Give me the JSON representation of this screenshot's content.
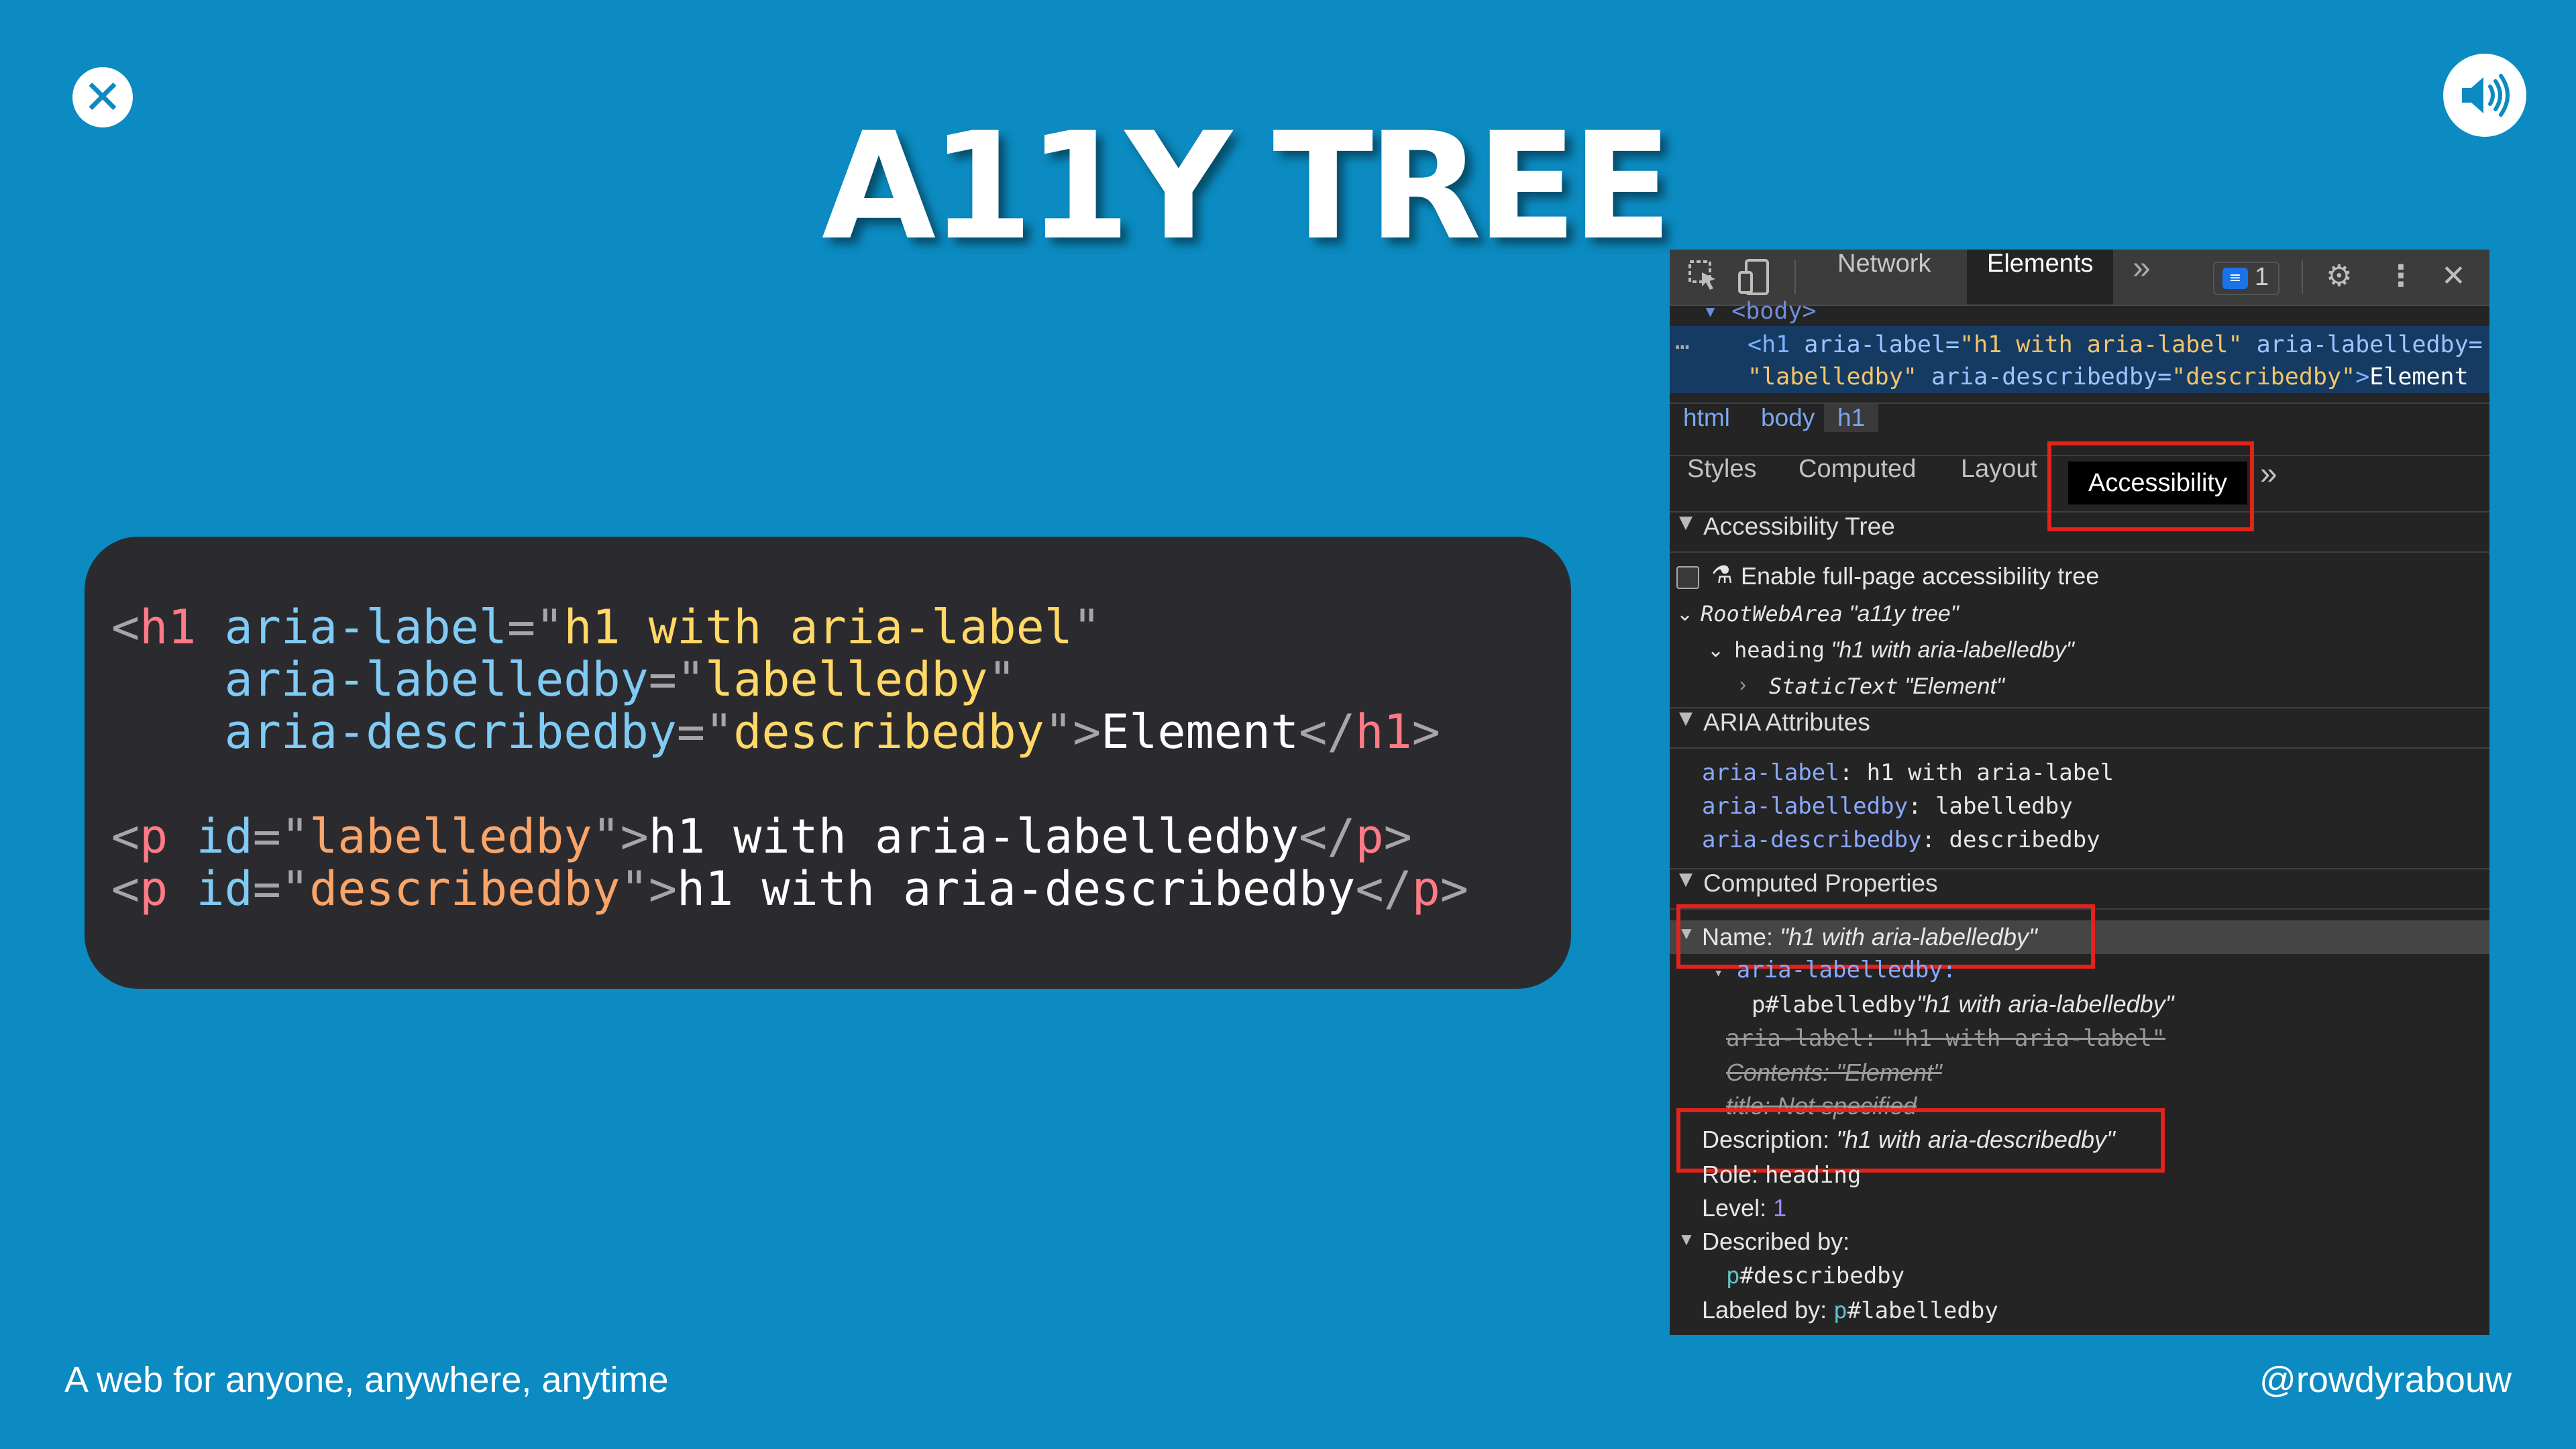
{
  "slide": {
    "title": "A11Y TREE",
    "footer_left": "A web for anyone, anywhere, anytime",
    "footer_right": "@rowdyrabouw",
    "close_icon": "close-icon",
    "sound_icon": "speaker-icon"
  },
  "code": {
    "l1": {
      "open": "<",
      "tag": "h1",
      "a1": "aria-label",
      "eq": "=",
      "q": "\"",
      "v1": "h1 with aria-label"
    },
    "l2": {
      "a2": "aria-labelledby",
      "v2": "labelledby"
    },
    "l3": {
      "a3": "aria-describedby",
      "v3": "describedby",
      "close": ">",
      "text": "Element",
      "end_open": "</",
      "tag": "h1",
      "end_close": ">"
    },
    "l5": {
      "tag": "p",
      "a": "id",
      "v": "labelledby",
      "text": "h1 with aria-labelledby"
    },
    "l6": {
      "tag": "p",
      "a": "id",
      "v": "describedby",
      "text": "h1 with aria-describedby"
    }
  },
  "devtools": {
    "tabs": {
      "network": "Network",
      "elements": "Elements",
      "more": "»",
      "issues_count": "1"
    },
    "dom": {
      "body_tag": "▾ <body>",
      "dots": "…",
      "line1": {
        "tag_open": "<h1 ",
        "a1": "aria-label",
        "v1": "\"h1 with aria-label\"",
        "a2": " aria-labelledby="
      },
      "line2": {
        "v2": "\"labelledby\"",
        "a3": " aria-describedby=",
        "v3": "\"describedby\"",
        "gt": ">",
        "text": "Element"
      }
    },
    "breadcrumbs": [
      "html",
      "body",
      "h1"
    ],
    "subtabs": {
      "styles": "Styles",
      "computed": "Computed",
      "layout": "Layout",
      "accessibility": "Accessibility",
      "more": "»"
    },
    "a11y_tree": {
      "header": "Accessibility Tree",
      "enable_label": "Enable full-page accessibility tree",
      "root": "RootWebArea",
      "root_name": "\"a11y tree\"",
      "heading": "heading",
      "heading_name": "\"h1 with aria-labelledby\"",
      "static": "StaticText",
      "static_name": "\"Element\""
    },
    "aria_attrs": {
      "header": "ARIA Attributes",
      "items": [
        {
          "key": "aria-label",
          "value": "h1 with aria-label"
        },
        {
          "key": "aria-labelledby",
          "value": "labelledby"
        },
        {
          "key": "aria-describedby",
          "value": "describedby"
        }
      ]
    },
    "computed": {
      "header": "Computed Properties",
      "name_key": "Name: ",
      "name_val": "\"h1 with aria-labelledby\"",
      "labelledby_key": "aria-labelledby:",
      "labelledby_ref": "p#labelledby",
      "labelledby_val": "\"h1 with aria-labelledby\"",
      "aria_label_struck": "aria-label: \"h1 with aria-label\"",
      "contents_struck": "Contents: \"Element\"",
      "title_struck": "title: Not specified",
      "desc_key": "Description: ",
      "desc_val": "\"h1 with aria-describedby\"",
      "role_key": "Role: ",
      "role_val": "heading",
      "level_key": "Level: ",
      "level_val": "1",
      "described_by": "Described by:",
      "described_ref_p": "p",
      "described_ref": "#describedby",
      "labeled_by": "Labeled by: ",
      "labeled_ref_p": "p",
      "labeled_ref": "#labelledby"
    }
  },
  "colors": {
    "slide_bg": "#0b8bc1",
    "highlight": "#e2231a",
    "code_bg": "#2b2b2f",
    "devtools_bg": "#242424"
  }
}
